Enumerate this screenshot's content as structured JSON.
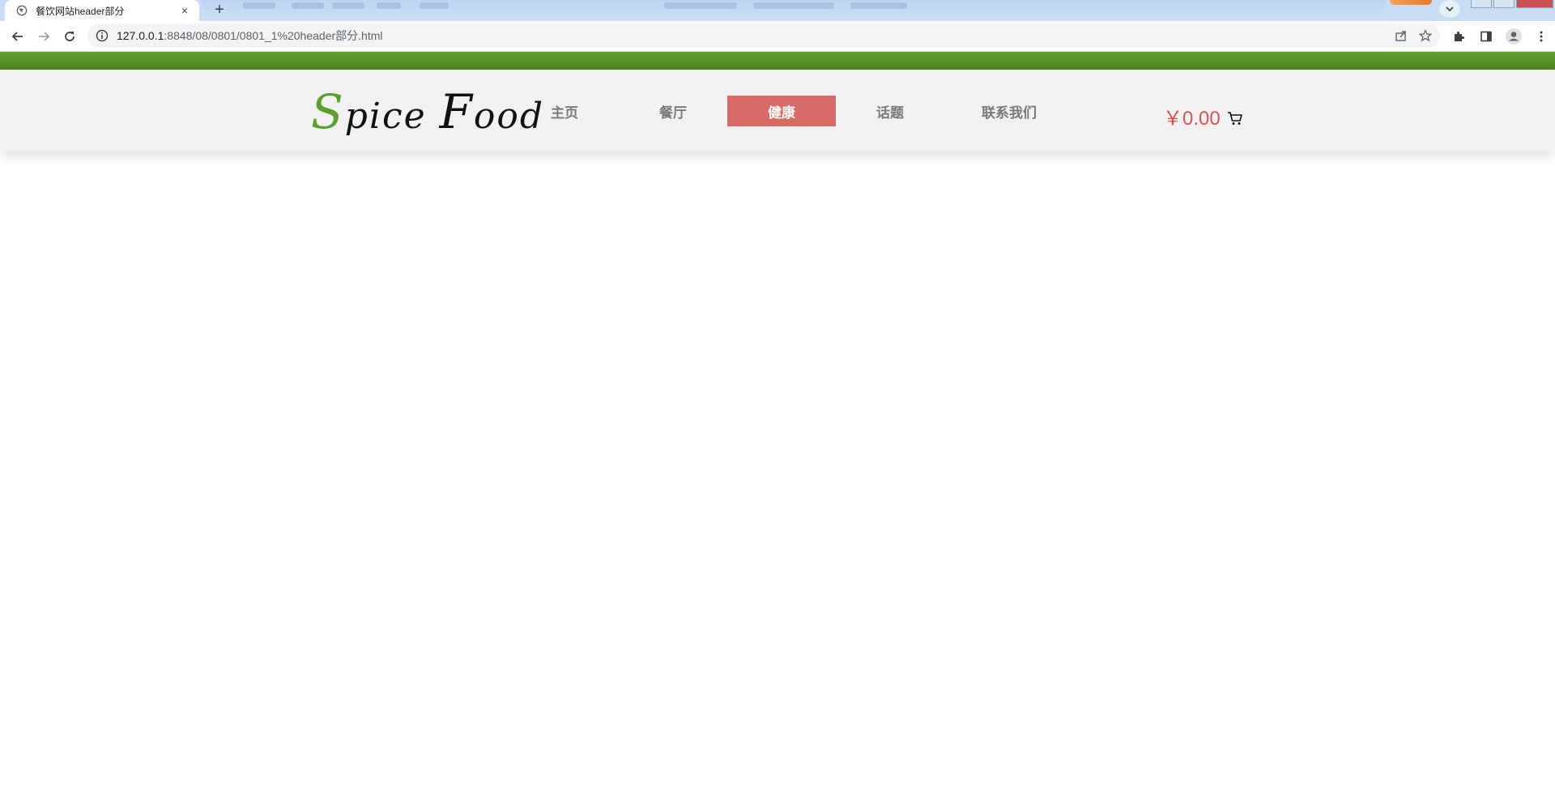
{
  "browser": {
    "tab_title": "餐饮网站header部分",
    "tab_close": "×",
    "new_tab": "+",
    "url_host": "127.0.0.1",
    "url_rest": ":8848/08/0801/0801_1%20header部分.html"
  },
  "site": {
    "logo_s": "S",
    "logo_pice": "pice ",
    "logo_f": "F",
    "logo_ood": "ood",
    "nav": [
      {
        "label": "主页"
      },
      {
        "label": "餐厅"
      },
      {
        "label": "健康",
        "active": true
      },
      {
        "label": "话题"
      },
      {
        "label": "联系我们"
      }
    ],
    "cart_price": "￥0.00"
  },
  "colors": {
    "green_strip": "#4c8020",
    "active_nav": "#d96a66",
    "price": "#d9534f",
    "logo_accent": "#5aa02c"
  }
}
